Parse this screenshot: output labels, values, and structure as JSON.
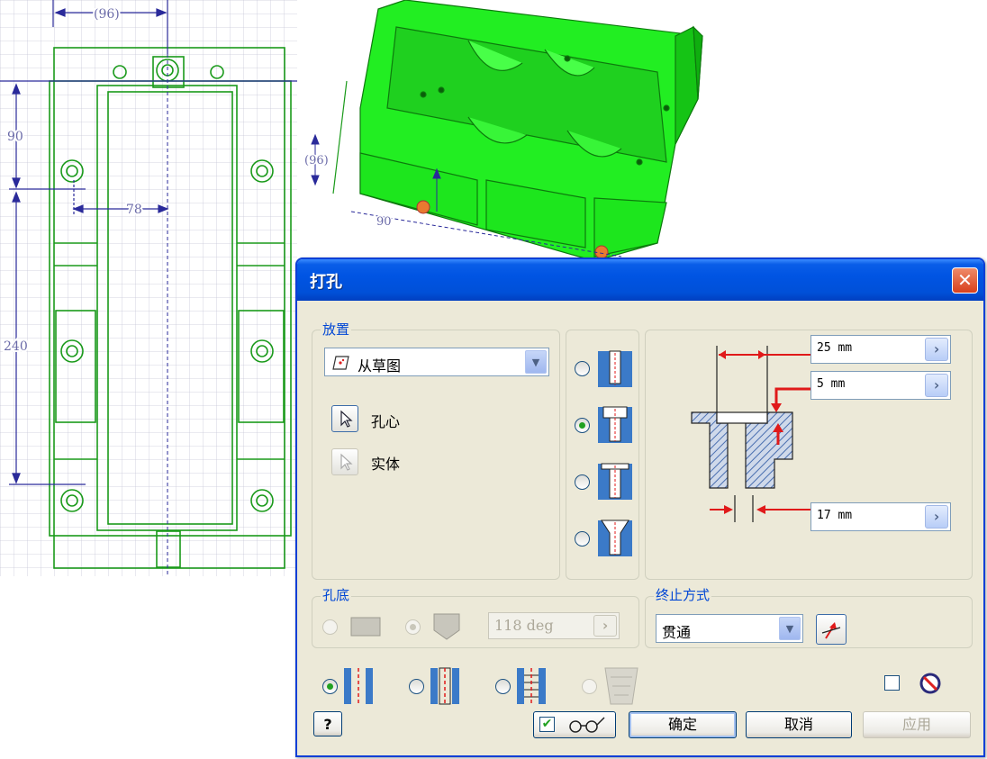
{
  "drawing": {
    "dim_top": "(96)",
    "dim_90": "90",
    "dim_78": "78",
    "dim_240": "240",
    "model_dim_96": "(96)",
    "model_dim_90": "90"
  },
  "dialog": {
    "title": "打孔",
    "close_glyph": "✕",
    "placement": {
      "group_label": "放置",
      "dropdown_value": "从草图",
      "hole_center_label": "孔心",
      "solid_label": "实体"
    },
    "hole_type_options": [
      "drilled",
      "counterbore",
      "spotface",
      "countersink"
    ],
    "hole_type_selected": 1,
    "dimensions": {
      "counterbore_diameter": "25 mm",
      "counterbore_depth": "5 mm",
      "hole_diameter": "17 mm"
    },
    "hole_bottom": {
      "group_label": "孔底",
      "angle": "118 deg"
    },
    "termination": {
      "group_label": "终止方式",
      "dropdown_value": "贯通"
    },
    "thread_type_selected": 0,
    "buttons": {
      "ok": "确定",
      "cancel": "取消",
      "apply": "应用",
      "help": "?"
    },
    "colors": {
      "titlebar": "#0054e3",
      "model_green": "#22ee22",
      "sketch_green": "#1a9a1a",
      "dimension_blue": "#2a2a9a",
      "highlight_red": "#e81c1c"
    }
  }
}
